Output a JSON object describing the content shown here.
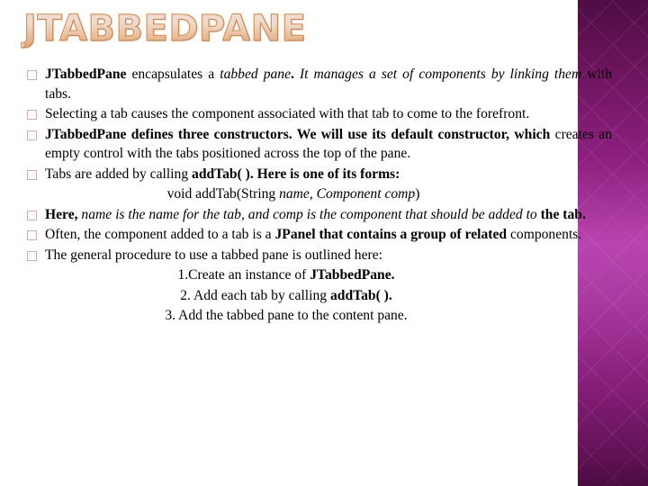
{
  "slide": {
    "title": "JTABBEDPANE",
    "bullet_marker": "hollow-square",
    "colors": {
      "band_top": "#4e0d45",
      "band_mid": "#b845ae",
      "band_bottom": "#4b0c42",
      "bullet_marker": "#d0a9c5",
      "title_outline": "#e08a4e",
      "text": "#000000",
      "background": "#ffffff"
    },
    "bullets": [
      {
        "id": "bullet-1",
        "runs": [
          {
            "text": "JTabbedPane",
            "bold": true,
            "italic": false
          },
          {
            "text": " encapsulates a ",
            "bold": false,
            "italic": false
          },
          {
            "text": "tabbed pane",
            "bold": false,
            "italic": true
          },
          {
            "text": ".",
            "bold": true,
            "italic": false
          },
          {
            "text": " It manages a set of components by linking them",
            "bold": false,
            "italic": true
          },
          {
            "text": " with tabs.",
            "bold": false,
            "italic": false
          }
        ]
      },
      {
        "id": "bullet-2",
        "runs": [
          {
            "text": "Selecting a tab causes the component associated with that tab to come to the forefront.",
            "bold": false,
            "italic": false
          }
        ]
      },
      {
        "id": "bullet-3",
        "runs": [
          {
            "text": "JTabbedPane defines three constructors. We will use its default constructor, which",
            "bold": true,
            "italic": false
          },
          {
            "text": " creates an empty control with the tabs positioned across the top of the pane.",
            "bold": false,
            "italic": false
          }
        ]
      },
      {
        "id": "bullet-4",
        "runs": [
          {
            "text": "Tabs are added by calling ",
            "bold": false,
            "italic": false
          },
          {
            "text": "addTab( ). Here is one of its forms:",
            "bold": true,
            "italic": false
          }
        ]
      },
      {
        "id": "bullet-5",
        "runs": [
          {
            "text": "Here,",
            "bold": true,
            "italic": false
          },
          {
            "text": " name is the name for the tab, and comp is the component that should be added to",
            "bold": false,
            "italic": true
          },
          {
            "text": " the tab.",
            "bold": true,
            "italic": false
          }
        ]
      },
      {
        "id": "bullet-6",
        "runs": [
          {
            "text": "Often, the component added to a tab is a ",
            "bold": false,
            "italic": false
          },
          {
            "text": "JPanel that contains a group of related",
            "bold": true,
            "italic": false
          },
          {
            "text": " components.",
            "bold": false,
            "italic": false
          }
        ]
      },
      {
        "id": "bullet-7",
        "runs": [
          {
            "text": "The general procedure to use a tabbed pane is outlined here:",
            "bold": false,
            "italic": false
          }
        ]
      }
    ],
    "code_line": {
      "id": "method-signature",
      "runs": [
        {
          "text": "void addTab(String ",
          "bold": false,
          "italic": false
        },
        {
          "text": "name, Component comp",
          "bold": false,
          "italic": true
        },
        {
          "text": ")",
          "bold": false,
          "italic": false
        }
      ]
    },
    "steps": [
      {
        "id": "step-1",
        "runs": [
          {
            "text": "1.Create an instance of ",
            "bold": false,
            "italic": false
          },
          {
            "text": "JTabbedPane.",
            "bold": true,
            "italic": false
          }
        ]
      },
      {
        "id": "step-2",
        "runs": [
          {
            "text": "2. Add each tab by calling ",
            "bold": false,
            "italic": false
          },
          {
            "text": "addTab( ).",
            "bold": true,
            "italic": false
          }
        ]
      },
      {
        "id": "step-3",
        "runs": [
          {
            "text": "3. Add the tabbed pane to the content pane.",
            "bold": false,
            "italic": false
          }
        ]
      }
    ]
  }
}
